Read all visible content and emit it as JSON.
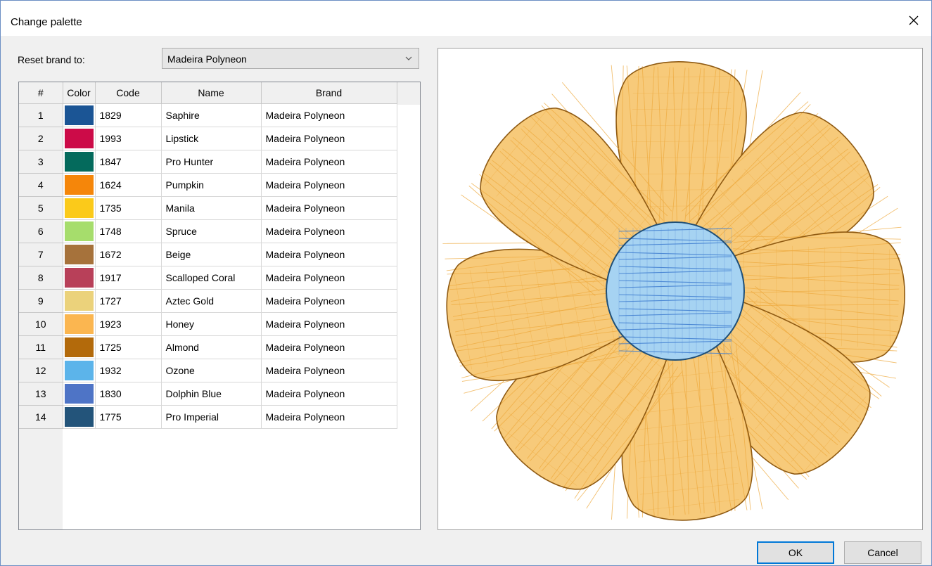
{
  "window": {
    "title": "Change palette",
    "close_icon": "close-icon"
  },
  "brand": {
    "label": "Reset brand to:",
    "selected": "Madeira Polyneon"
  },
  "table": {
    "headers": {
      "num": "#",
      "color": "Color",
      "code": "Code",
      "name": "Name",
      "brand": "Brand"
    },
    "rows": [
      {
        "num": "1",
        "color": "#1b5595",
        "code": "1829",
        "name": "Saphire",
        "brand": "Madeira Polyneon"
      },
      {
        "num": "2",
        "color": "#cc0b48",
        "code": "1993",
        "name": "Lipstick",
        "brand": "Madeira Polyneon"
      },
      {
        "num": "3",
        "color": "#046a5c",
        "code": "1847",
        "name": "Pro Hunter",
        "brand": "Madeira Polyneon"
      },
      {
        "num": "4",
        "color": "#f5860a",
        "code": "1624",
        "name": "Pumpkin",
        "brand": "Madeira Polyneon"
      },
      {
        "num": "5",
        "color": "#fbca1a",
        "code": "1735",
        "name": "Manila",
        "brand": "Madeira Polyneon"
      },
      {
        "num": "6",
        "color": "#a6dd6c",
        "code": "1748",
        "name": "Spruce",
        "brand": "Madeira Polyneon"
      },
      {
        "num": "7",
        "color": "#a6723b",
        "code": "1672",
        "name": "Beige",
        "brand": "Madeira Polyneon"
      },
      {
        "num": "8",
        "color": "#b84059",
        "code": "1917",
        "name": "Scalloped Coral",
        "brand": "Madeira Polyneon"
      },
      {
        "num": "9",
        "color": "#ebd27b",
        "code": "1727",
        "name": "Aztec Gold",
        "brand": "Madeira Polyneon"
      },
      {
        "num": "10",
        "color": "#fbb650",
        "code": "1923",
        "name": "Honey",
        "brand": "Madeira Polyneon"
      },
      {
        "num": "11",
        "color": "#b36a0b",
        "code": "1725",
        "name": "Almond",
        "brand": "Madeira Polyneon"
      },
      {
        "num": "12",
        "color": "#5cb4ea",
        "code": "1932",
        "name": "Ozone",
        "brand": "Madeira Polyneon"
      },
      {
        "num": "13",
        "color": "#4e74c6",
        "code": "1830",
        "name": "Dolphin Blue",
        "brand": "Madeira Polyneon"
      },
      {
        "num": "14",
        "color": "#23547a",
        "code": "1775",
        "name": "Pro Imperial",
        "brand": "Madeira Polyneon"
      }
    ]
  },
  "buttons": {
    "ok": "OK",
    "cancel": "Cancel"
  },
  "preview": {
    "petal_fill": "#f7ca7a",
    "petal_stitch": "#eeaa3f",
    "petal_outline": "#8f5a12",
    "center_fill": "#a6d3f2",
    "center_stitch": "#3f7ed1",
    "center_outline": "#1f4f78"
  }
}
